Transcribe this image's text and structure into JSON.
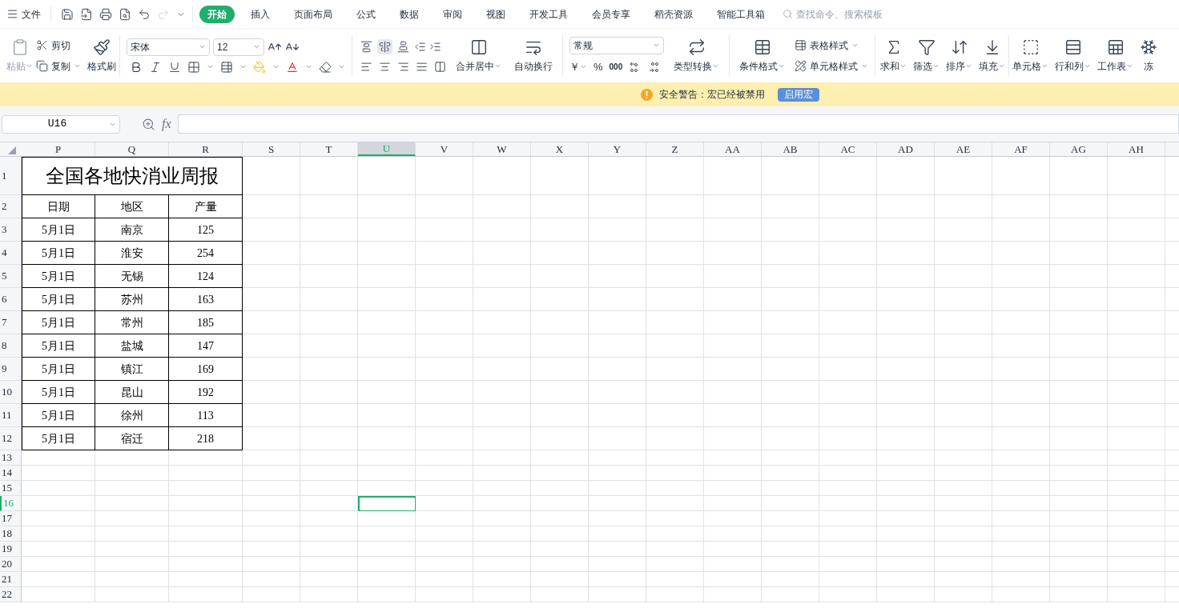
{
  "menu_bar": {
    "file": "文件",
    "tabs": [
      {
        "label": "开始",
        "selected": true
      },
      {
        "label": "插入",
        "selected": false
      },
      {
        "label": "页面布局",
        "selected": false
      },
      {
        "label": "公式",
        "selected": false
      },
      {
        "label": "数据",
        "selected": false
      },
      {
        "label": "审阅",
        "selected": false
      },
      {
        "label": "视图",
        "selected": false
      },
      {
        "label": "开发工具",
        "selected": false
      },
      {
        "label": "会员专享",
        "selected": false
      },
      {
        "label": "稻壳资源",
        "selected": false
      },
      {
        "label": "智能工具箱",
        "selected": false
      }
    ],
    "search": {
      "placeholder": "查找命令、搜索模板"
    }
  },
  "ribbon": {
    "clipboard": {
      "paste": "粘贴",
      "cut": "剪切",
      "copy": "复制",
      "format_painter": "格式刷"
    },
    "font": {
      "name": "宋体",
      "size": "12"
    },
    "vertical_align": [
      {
        "selected": false
      },
      {
        "selected": true
      },
      {
        "selected": false
      }
    ],
    "alignment": {
      "merge": "合并居中",
      "wrap": "自动换行"
    },
    "number": {
      "format": "常规",
      "currency": "￥",
      "percent": "%",
      "thousands": "000",
      "convert": "类型转换"
    },
    "styles": {
      "conditional": "条件格式",
      "table_style": "表格样式",
      "cell_style": "单元格样式"
    },
    "tools": [
      {
        "kind": "sum",
        "label": "求和"
      },
      {
        "kind": "filter",
        "label": "筛选"
      },
      {
        "kind": "sort",
        "label": "排序"
      },
      {
        "kind": "fill",
        "label": "填充"
      },
      {
        "kind": "cell",
        "label": "单元格"
      },
      {
        "kind": "rowcol",
        "label": "行和列"
      },
      {
        "kind": "sheet",
        "label": "工作表"
      },
      {
        "kind": "freeze",
        "label": "冻"
      }
    ]
  },
  "warning_bar": {
    "text": "安全警告：宏已经被禁用",
    "button": "启用宏"
  },
  "formula_bar": {
    "name_box": "U16",
    "fx": "fx"
  },
  "sheet": {
    "columns": [
      {
        "label": "P",
        "selected": false
      },
      {
        "label": "Q",
        "selected": false
      },
      {
        "label": "R",
        "selected": false
      },
      {
        "label": "S",
        "selected": false
      },
      {
        "label": "T",
        "selected": false
      },
      {
        "label": "U",
        "selected": true
      },
      {
        "label": "V",
        "selected": false
      },
      {
        "label": "W",
        "selected": false
      },
      {
        "label": "X",
        "selected": false
      },
      {
        "label": "Y",
        "selected": false
      },
      {
        "label": "Z",
        "selected": false
      },
      {
        "label": "AA",
        "selected": false
      },
      {
        "label": "AB",
        "selected": false
      },
      {
        "label": "AC",
        "selected": false
      },
      {
        "label": "AD",
        "selected": false
      },
      {
        "label": "AE",
        "selected": false
      },
      {
        "label": "AF",
        "selected": false
      },
      {
        "label": "AG",
        "selected": false
      },
      {
        "label": "AH",
        "selected": false
      }
    ],
    "rows": [
      {
        "label": "1",
        "kind": "title",
        "selected": false,
        "cells": [
          "全国各地快消业周报"
        ]
      },
      {
        "label": "2",
        "kind": "table",
        "selected": false,
        "cells": [
          "日期",
          "地区",
          "产量"
        ]
      },
      {
        "label": "3",
        "kind": "table",
        "selected": false,
        "cells": [
          "5月1日",
          "南京",
          "125"
        ]
      },
      {
        "label": "4",
        "kind": "table",
        "selected": false,
        "cells": [
          "5月1日",
          "淮安",
          "254"
        ]
      },
      {
        "label": "5",
        "kind": "table",
        "selected": false,
        "cells": [
          "5月1日",
          "无锡",
          "124"
        ]
      },
      {
        "label": "6",
        "kind": "table",
        "selected": false,
        "cells": [
          "5月1日",
          "苏州",
          "163"
        ]
      },
      {
        "label": "7",
        "kind": "table",
        "selected": false,
        "cells": [
          "5月1日",
          "常州",
          "185"
        ]
      },
      {
        "label": "8",
        "kind": "table",
        "selected": false,
        "cells": [
          "5月1日",
          "盐城",
          "147"
        ]
      },
      {
        "label": "9",
        "kind": "table",
        "selected": false,
        "cells": [
          "5月1日",
          "镇江",
          "169"
        ]
      },
      {
        "label": "10",
        "kind": "table",
        "selected": false,
        "cells": [
          "5月1日",
          "昆山",
          "192"
        ]
      },
      {
        "label": "11",
        "kind": "table",
        "selected": false,
        "cells": [
          "5月1日",
          "徐州",
          "113"
        ]
      },
      {
        "label": "12",
        "kind": "table",
        "selected": false,
        "cells": [
          "5月1日",
          "宿迁",
          "218"
        ]
      },
      {
        "label": "13",
        "kind": "empty",
        "selected": false
      },
      {
        "label": "14",
        "kind": "empty",
        "selected": false
      },
      {
        "label": "15",
        "kind": "empty",
        "selected": false
      },
      {
        "label": "16",
        "kind": "empty",
        "selected": true
      },
      {
        "label": "17",
        "kind": "empty",
        "selected": false
      },
      {
        "label": "18",
        "kind": "empty",
        "selected": false
      },
      {
        "label": "19",
        "kind": "empty",
        "selected": false
      },
      {
        "label": "20",
        "kind": "empty",
        "selected": false
      },
      {
        "label": "21",
        "kind": "empty",
        "selected": false
      },
      {
        "label": "22",
        "kind": "empty",
        "selected": false
      }
    ]
  }
}
